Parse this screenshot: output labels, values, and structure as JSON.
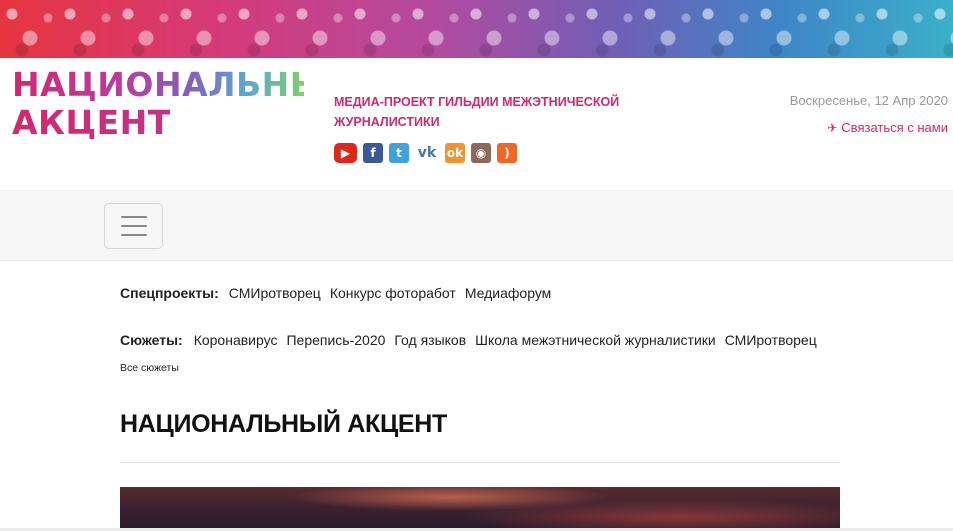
{
  "site": {
    "logo_line1": "НАЦИОНАЛЬНЫЙ",
    "logo_line2": "АКЦЕНТ",
    "tagline": "МЕДИА-ПРОЕКТ ГИЛЬДИИ МЕЖЭТНИЧЕСКОЙ ЖУРНАЛИСТИКИ",
    "accent_color": "#d6266e"
  },
  "socials": [
    {
      "icon": "youtube-icon",
      "glyph": "▶"
    },
    {
      "icon": "facebook-icon",
      "glyph": "f"
    },
    {
      "icon": "twitter-icon",
      "glyph": "t"
    },
    {
      "icon": "vk-icon",
      "glyph": "vk"
    },
    {
      "icon": "odnoklassniki-icon",
      "glyph": "ok"
    },
    {
      "icon": "instagram-icon",
      "glyph": "◉"
    },
    {
      "icon": "rss-icon",
      "glyph": ")"
    }
  ],
  "header": {
    "date": "Воскресенье, 12 Апр 2020",
    "contact_label": "Связаться с нами",
    "contact_icon": "paper-plane-icon"
  },
  "specprojects": {
    "label": "Спецпроекты:",
    "items": [
      "СМИротворец",
      "Конкурс фоторабот",
      "Медиафорум"
    ]
  },
  "stories": {
    "label": "Сюжеты:",
    "items": [
      "Коронавирус",
      "Перепись-2020",
      "Год языков",
      "Школа межэтнической журналистики",
      "СМИротворец"
    ],
    "all_label": "Все сюжеты"
  },
  "main": {
    "headline": "НАЦИОНАЛЬНЫЙ АКЦЕНТ"
  }
}
